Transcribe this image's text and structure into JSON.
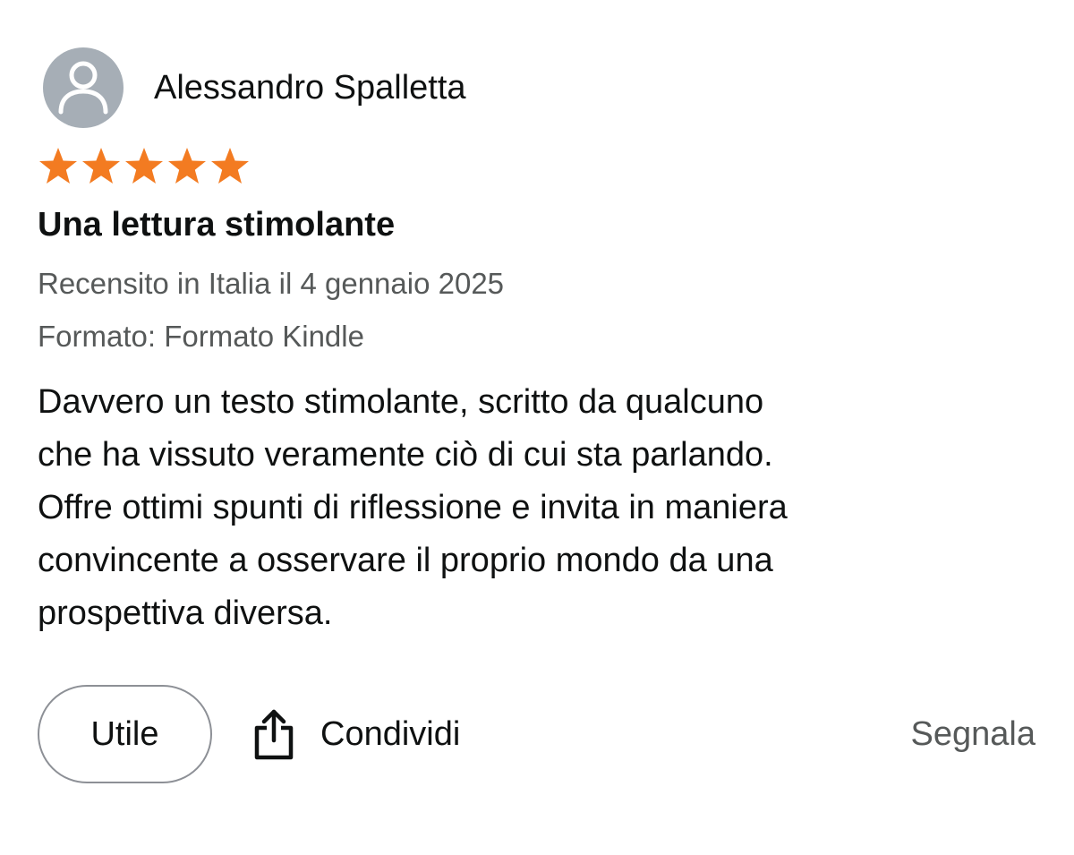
{
  "reviewer": {
    "name": "Alessandro Spalletta",
    "avatar_icon": "default-user-icon"
  },
  "rating": {
    "value": 5,
    "max": 5,
    "color": "#f37b21"
  },
  "review": {
    "title": "Una lettura stimolante",
    "date_line": "Recensito in Italia il 4 gennaio 2025",
    "format_line": "Formato: Formato Kindle",
    "body_lines": [
      "Davvero un testo stimolante, scritto da qualcuno",
      "che ha vissuto veramente ciò di cui sta parlando.",
      "Offre ottimi spunti di riflessione e invita in maniera",
      "convincente a osservare il proprio mondo da una",
      "prospettiva diversa."
    ]
  },
  "actions": {
    "helpful_label": "Utile",
    "share_label": "Condividi",
    "share_icon": "share-icon",
    "report_label": "Segnala"
  }
}
